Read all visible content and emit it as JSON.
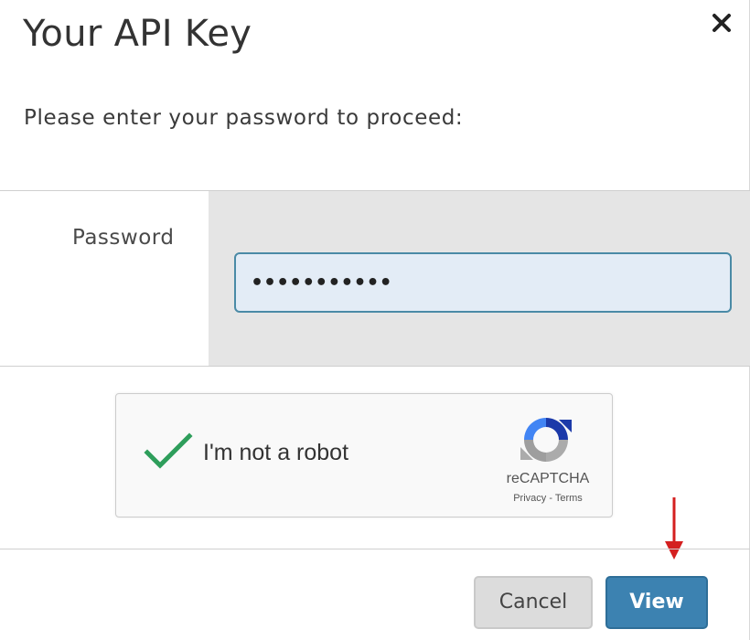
{
  "dialog": {
    "title": "Your API Key",
    "prompt": "Please enter your password to proceed:",
    "close_icon": "close-icon"
  },
  "form": {
    "password_label": "Password",
    "password_value": "•••••••••••",
    "input_accent": "#4a8aa6",
    "input_bg": "#e3ecf6"
  },
  "recaptcha": {
    "label": "I'm not a robot",
    "checked": true,
    "check_color": "#2e9e5b",
    "brand": "reCAPTCHA",
    "privacy": "Privacy",
    "separator": " - ",
    "terms": "Terms"
  },
  "buttons": {
    "cancel": "Cancel",
    "view": "View",
    "view_color": "#3c82b1"
  },
  "annotation": {
    "arrow_color": "#d42020",
    "arrow_icon": "red-arrow-down-icon"
  }
}
